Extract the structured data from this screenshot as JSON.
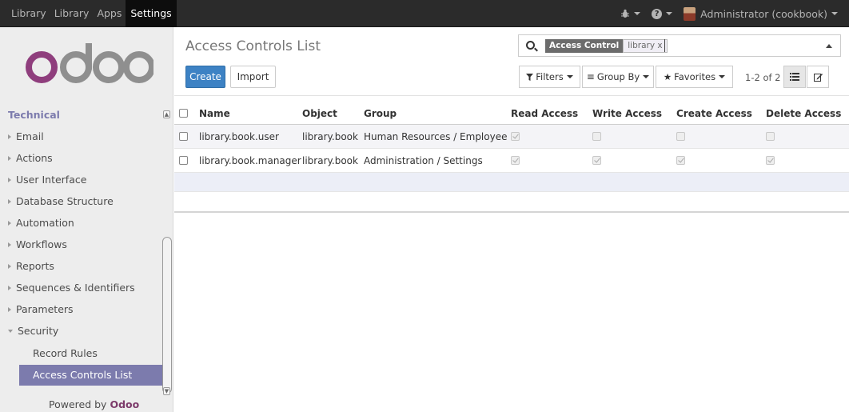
{
  "topbar": {
    "menu": [
      "Library",
      "Library",
      "Apps",
      "Settings"
    ],
    "active_index": 3,
    "user_label": "Administrator (cookbook)"
  },
  "sidebar": {
    "logo_text": "odoo",
    "section": "Technical",
    "items": [
      "Email",
      "Actions",
      "User Interface",
      "Database Structure",
      "Automation",
      "Workflows",
      "Reports",
      "Sequences & Identifiers",
      "Parameters",
      "Security"
    ],
    "sub_items": [
      "Record Rules",
      "Access Controls List"
    ],
    "powered_prefix": "Powered by",
    "powered_brand": "Odoo"
  },
  "control_panel": {
    "title": "Access Controls List",
    "create_label": "Create",
    "import_label": "Import",
    "facet_label": "Access Control",
    "facet_value": "library x",
    "filters_label": "Filters",
    "groupby_label": "Group By",
    "favorites_label": "Favorites",
    "pager": "1-2 of 2"
  },
  "table": {
    "columns": [
      "Name",
      "Object",
      "Group",
      "Read Access",
      "Write Access",
      "Create Access",
      "Delete Access"
    ],
    "rows": [
      {
        "name": "library.book.user",
        "object": "library.book",
        "group": "Human Resources / Employee",
        "read": true,
        "write": false,
        "create": false,
        "delete": false
      },
      {
        "name": "library.book.manager",
        "object": "library.book",
        "group": "Administration / Settings",
        "read": true,
        "write": true,
        "create": true,
        "delete": true
      }
    ]
  },
  "colors": {
    "brand": "#7c7bad",
    "primary_button": "#3d82c4",
    "topbar": "#2b2b2b"
  }
}
